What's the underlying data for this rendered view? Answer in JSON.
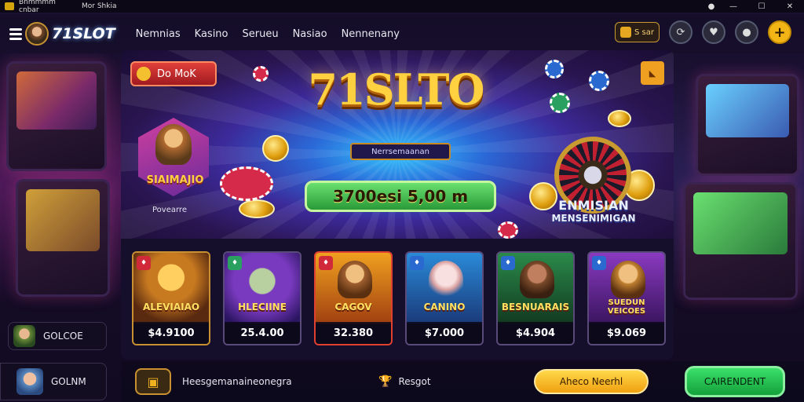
{
  "window": {
    "title_primary": "Bnmmmm cnbar",
    "title_secondary": "Mor Shkia",
    "controls": {
      "minimize": "—",
      "maximize": "☐",
      "close": "✕",
      "status": "●"
    }
  },
  "nav": {
    "brand": "71SLOT",
    "links": [
      "Nemnias",
      "Kasino",
      "Serueu",
      "Nasiao",
      "Nennenany"
    ],
    "coin_label": "S sar"
  },
  "hero": {
    "promo_button": "Do MoK",
    "logo_title": "71SLTO",
    "logo_subtitle": "Nerrsemaanan",
    "jackpot": "3700esi 5,00 m",
    "featured": {
      "label": "SIAIMAJIO",
      "sub": "Povearre"
    },
    "roulette_label": "ENMISIAN",
    "roulette_sub": "MENSENIMIGAN"
  },
  "games": [
    {
      "name": "ALEVIAIAO",
      "price": "$4.9100",
      "tag": "♦",
      "art_color_a": "#c87a20",
      "art_color_b": "#5a2a10"
    },
    {
      "name": "HLECIINE",
      "price": "25.4.00",
      "tag": "♦",
      "art_color_a": "#7a3ac0",
      "art_color_b": "#2a1560"
    },
    {
      "name": "CAGOV",
      "price": "32.380",
      "tag": "♦",
      "art_color_a": "#f0a020",
      "art_color_b": "#a04010"
    },
    {
      "name": "CANINO",
      "price": "$7.000",
      "tag": "♦",
      "art_color_a": "#2a8ad8",
      "art_color_b": "#1a3a7a"
    },
    {
      "name": "BESNUARAIS",
      "price": "$4.904",
      "tag": "♦",
      "art_color_a": "#2a8a4a",
      "art_color_b": "#123a20"
    },
    {
      "name": "SUEDUN VEICOES",
      "price": "$9.069",
      "tag": "♦",
      "art_color_a": "#8a3ac0",
      "art_color_b": "#3a1560"
    }
  ],
  "sidebar": {
    "pill_1": "GOLCOE",
    "pill_2": "GOLNM"
  },
  "bottom": {
    "left_text": "Heesgemanaineonegra",
    "mid_text": "Resgot",
    "yellow_button": "Aheco Neerhl",
    "green_button": "CAIRENDENT"
  }
}
